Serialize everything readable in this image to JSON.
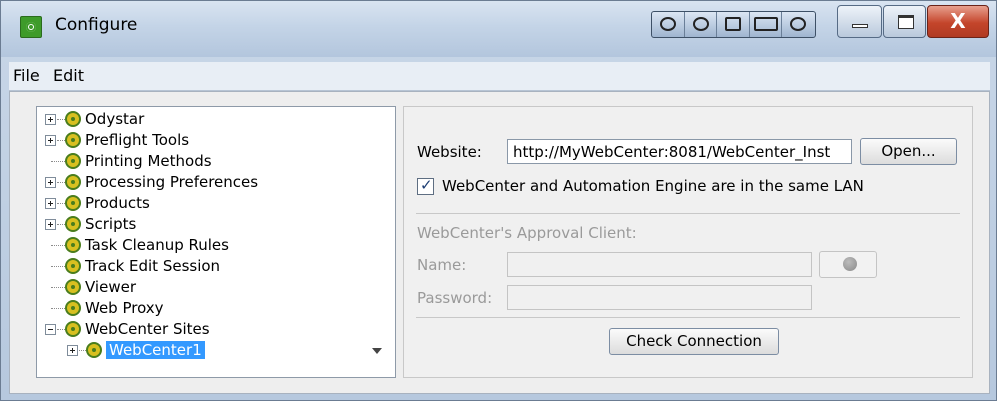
{
  "window": {
    "title": "Configure"
  },
  "menu": {
    "file": "File",
    "edit": "Edit"
  },
  "tree": {
    "items": [
      {
        "label": "Odystar",
        "expandable": true
      },
      {
        "label": "Preflight Tools",
        "expandable": true
      },
      {
        "label": "Printing Methods",
        "expandable": false
      },
      {
        "label": "Processing Preferences",
        "expandable": true
      },
      {
        "label": "Products",
        "expandable": true
      },
      {
        "label": "Scripts",
        "expandable": true
      },
      {
        "label": "Task Cleanup Rules",
        "expandable": false
      },
      {
        "label": "Track Edit Session",
        "expandable": false
      },
      {
        "label": "Viewer",
        "expandable": false
      },
      {
        "label": "Web Proxy",
        "expandable": false
      },
      {
        "label": "WebCenter Sites",
        "expandable": true,
        "expanded": true
      },
      {
        "label": "WebCenter1",
        "expandable": true,
        "selected": true
      }
    ]
  },
  "form": {
    "website_label": "Website:",
    "website_value": "http://MyWebCenter:8081/WebCenter_Inst",
    "open_button": "Open...",
    "same_lan_label": "WebCenter and Automation Engine are in the same LAN",
    "same_lan_checked": true,
    "approval_section_label": "WebCenter's Approval Client:",
    "name_label": "Name:",
    "name_value": "",
    "password_label": "Password:",
    "password_value": "",
    "check_connection_button": "Check Connection"
  },
  "icons": {
    "app": "app-configure-icon",
    "tree_node": "gear-icon",
    "info": "info-icon"
  }
}
